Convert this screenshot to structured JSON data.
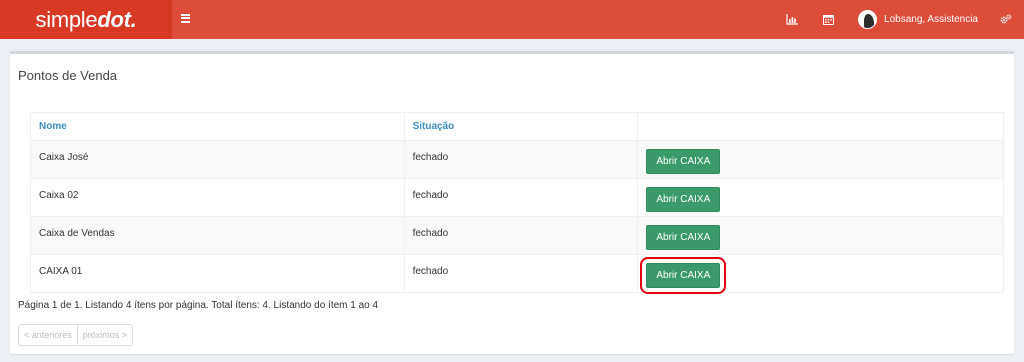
{
  "header": {
    "logo_light": "simple",
    "logo_bold": "dot.",
    "brand_color": "#dd4b39",
    "icons": [
      "menu-icon",
      "bar-chart-icon",
      "calendar-icon",
      "gears-icon"
    ],
    "user_name": "Lobsang, Assistencia"
  },
  "page": {
    "title": "Pontos de Venda"
  },
  "table": {
    "columns": [
      "Nome",
      "Situação",
      ""
    ],
    "rows": [
      {
        "nome": "Caixa José",
        "situacao": "fechado",
        "action": "Abrir CAIXA"
      },
      {
        "nome": "Caixa 02",
        "situacao": "fechado",
        "action": "Abrir CAIXA"
      },
      {
        "nome": "Caixa de Vendas",
        "situacao": "fechado",
        "action": "Abrir CAIXA"
      },
      {
        "nome": "CAIXA 01",
        "situacao": "fechado",
        "action": "Abrir CAIXA"
      }
    ],
    "button_color": "#3a9a6a"
  },
  "pagination": {
    "summary": "Página 1 de 1. Listando 4 ítens por página. Total ítens: 4. Listando do ítem 1 ao 4",
    "prev_label": "< anteriores",
    "next_label": "próximos >"
  }
}
